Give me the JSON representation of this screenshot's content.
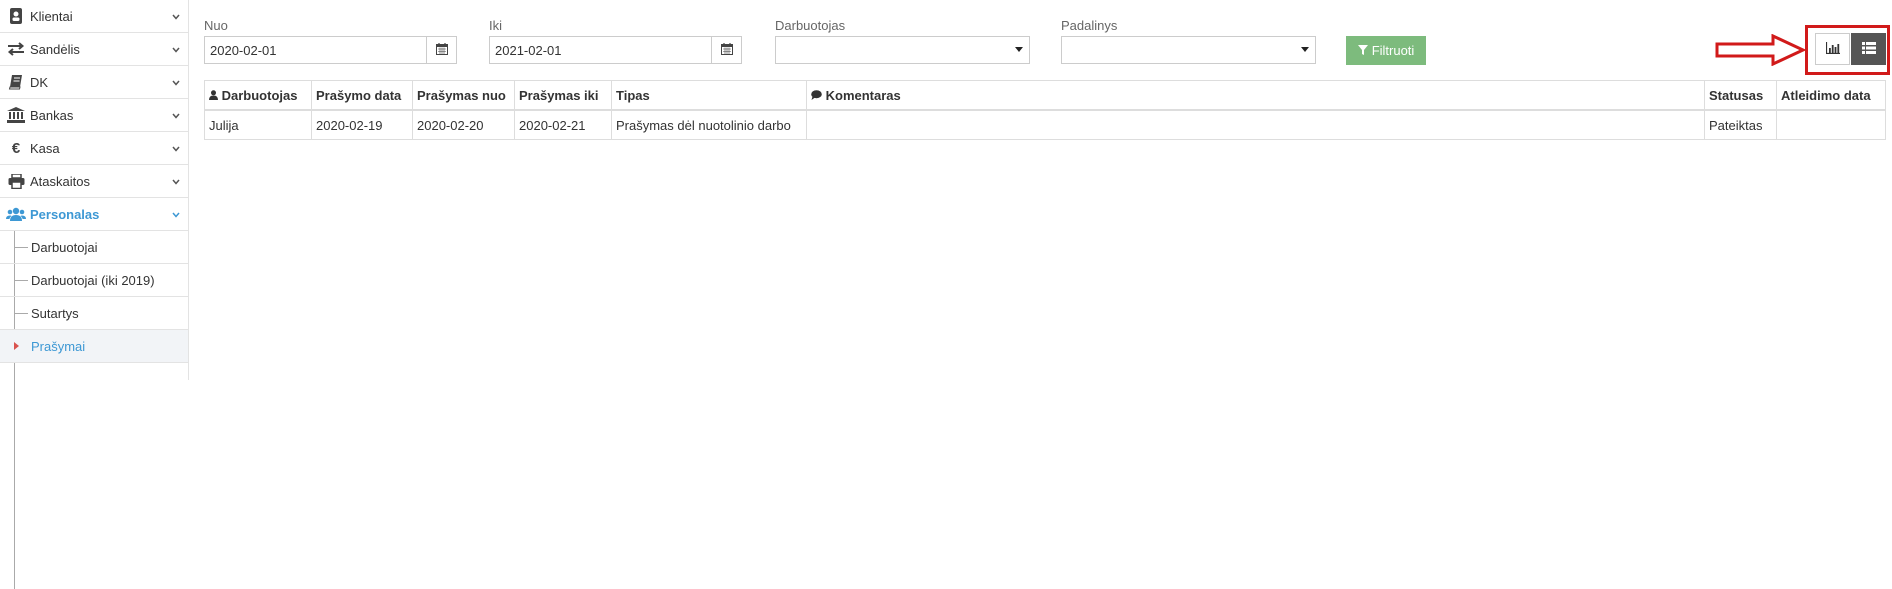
{
  "sidebar": {
    "items": [
      {
        "label": "Klientai",
        "icon": "client-card-icon"
      },
      {
        "label": "Sandėlis",
        "icon": "exchange-icon"
      },
      {
        "label": "DK",
        "icon": "book-icon"
      },
      {
        "label": "Bankas",
        "icon": "bank-icon"
      },
      {
        "label": "Kasa",
        "icon": "euro-icon"
      },
      {
        "label": "Ataskaitos",
        "icon": "printer-icon"
      },
      {
        "label": "Personalas",
        "icon": "users-icon",
        "active": true
      }
    ],
    "sub_items": [
      {
        "label": "Darbuotojai"
      },
      {
        "label": "Darbuotojai (iki 2019)"
      },
      {
        "label": "Sutartys"
      },
      {
        "label": "Prašymai",
        "active": true
      }
    ]
  },
  "filters": {
    "from": {
      "label": "Nuo",
      "value": "2020-02-01"
    },
    "to": {
      "label": "Iki",
      "value": "2021-02-01"
    },
    "employee": {
      "label": "Darbuotojas",
      "value": ""
    },
    "department": {
      "label": "Padalinys",
      "value": ""
    },
    "filter_button": "Filtruoti"
  },
  "table": {
    "headers": [
      "Darbuotojas",
      "Prašymo data",
      "Prašymas nuo",
      "Prašymas iki",
      "Tipas",
      "Komentaras",
      "Statusas",
      "Atleidimo data"
    ],
    "rows": [
      [
        "Julija",
        "2020-02-19",
        "2020-02-20",
        "2020-02-21",
        "Prašymas dėl nuotolinio darbo",
        "",
        "Pateiktas",
        ""
      ]
    ]
  },
  "colors": {
    "accent": "#3d98d4",
    "filter_button": "#7dbb7d",
    "highlight": "#d11a1a",
    "list_button": "#555555"
  }
}
